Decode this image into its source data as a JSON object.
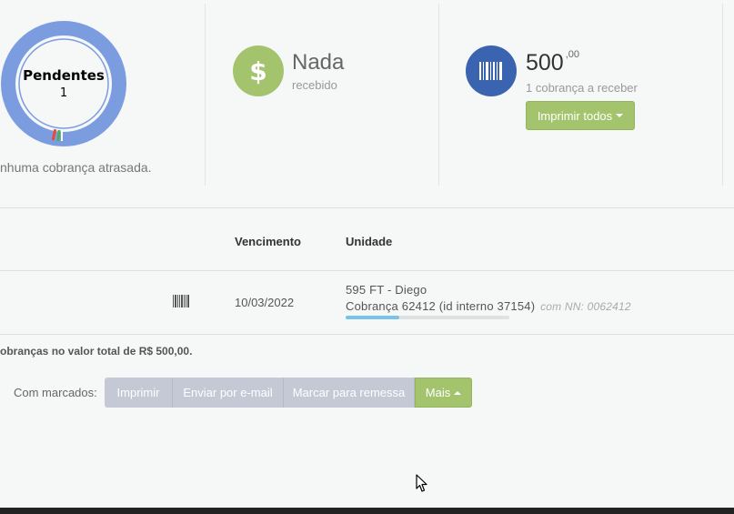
{
  "summary": {
    "pending": {
      "title": "Pendentes",
      "count": "1",
      "status": "nhuma cobrança atrasada."
    },
    "received": {
      "value": "Nada",
      "label": "recebido",
      "icon": "dollar-icon",
      "color": "#a3c46c"
    },
    "receivable": {
      "value": "500",
      "cents": ",00",
      "label": "1 cobrança a receber",
      "icon": "barcode-icon",
      "color": "#3a63b0",
      "print_all_label": "Imprimir todos"
    }
  },
  "table": {
    "headers": {
      "vencimento": "Vencimento",
      "unidade": "Unidade"
    },
    "rows": [
      {
        "due_date": "10/03/2022",
        "unit": "595 FT - Diego",
        "charge": "Cobrança 62412 (id interno 37154)",
        "nn": "com NN: 0062412",
        "progress": 0.33
      }
    ]
  },
  "totals_text": "obranças no valor total de R$ 500,00.",
  "bulk_actions": {
    "label": "Com marcados:",
    "print": "Imprimir",
    "email": "Enviar por e-mail",
    "remessa": "Marcar para remessa",
    "more": "Mais"
  },
  "colors": {
    "donut": "#7b9de0",
    "accent_green": "#a3c46c",
    "progress": "#7ac3e8"
  }
}
